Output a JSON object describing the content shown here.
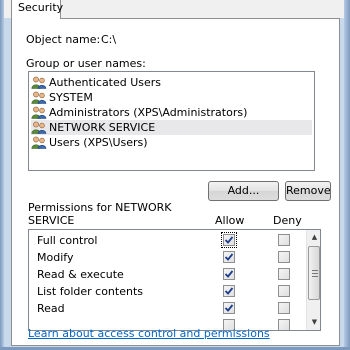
{
  "tabs": [
    {
      "label": "Security",
      "active": true
    }
  ],
  "object": {
    "label": "Object name:",
    "value": "C:\\"
  },
  "group_label": "Group or user names:",
  "users": [
    {
      "name": "Authenticated Users",
      "selected": false
    },
    {
      "name": "SYSTEM",
      "selected": false
    },
    {
      "name": "Administrators (XPS\\Administrators)",
      "selected": false
    },
    {
      "name": "NETWORK SERVICE",
      "selected": true
    },
    {
      "name": "Users (XPS\\Users)",
      "selected": false
    }
  ],
  "buttons": {
    "add": "Add...",
    "remove": "Remove"
  },
  "permissions": {
    "header_line1": "Permissions for NETWORK",
    "header_line2": "SERVICE",
    "allow_label": "Allow",
    "deny_label": "Deny",
    "rows": [
      {
        "name": "Full control",
        "allow": true,
        "deny": false
      },
      {
        "name": "Modify",
        "allow": true,
        "deny": false
      },
      {
        "name": "Read & execute",
        "allow": true,
        "deny": false
      },
      {
        "name": "List folder contents",
        "allow": true,
        "deny": false
      },
      {
        "name": "Read",
        "allow": true,
        "deny": false
      }
    ]
  },
  "help_link": "Learn about access control and permissions",
  "colors": {
    "link": "#0066cc",
    "check": "#1c3c8c",
    "selection": "#e8e8ea"
  }
}
